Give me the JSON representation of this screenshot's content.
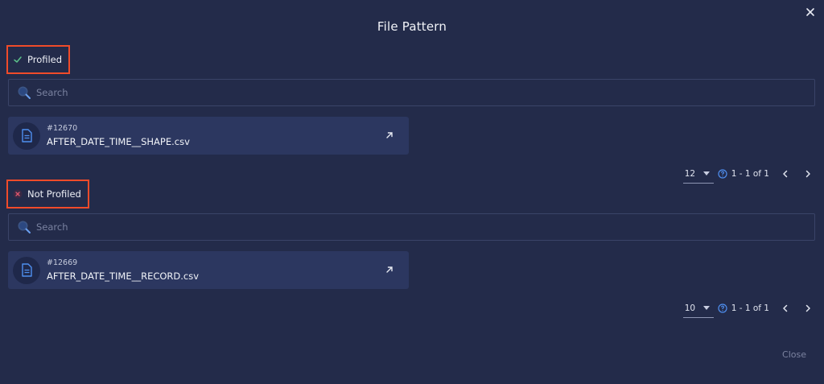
{
  "dialog": {
    "title": "File Pattern",
    "close_label": "Close"
  },
  "sections": [
    {
      "status": "Profiled",
      "status_icon": "check-icon",
      "status_color": "#5cc28a",
      "search_placeholder": "Search",
      "files": [
        {
          "id": "#12670",
          "name": "AFTER_DATE_TIME__SHAPE.csv"
        }
      ],
      "pagination": {
        "page_size": "12",
        "range": "1 - 1 of 1"
      }
    },
    {
      "status": "Not Profiled",
      "status_icon": "x-icon",
      "status_color": "#e0566d",
      "search_placeholder": "Search",
      "files": [
        {
          "id": "#12669",
          "name": "AFTER_DATE_TIME__RECORD.csv"
        }
      ],
      "pagination": {
        "page_size": "10",
        "range": "1 - 1 of 1"
      }
    }
  ],
  "colors": {
    "background": "#232b4a",
    "card": "#2c3760",
    "highlight": "#f04b2a",
    "accent": "#3f7ee8"
  }
}
